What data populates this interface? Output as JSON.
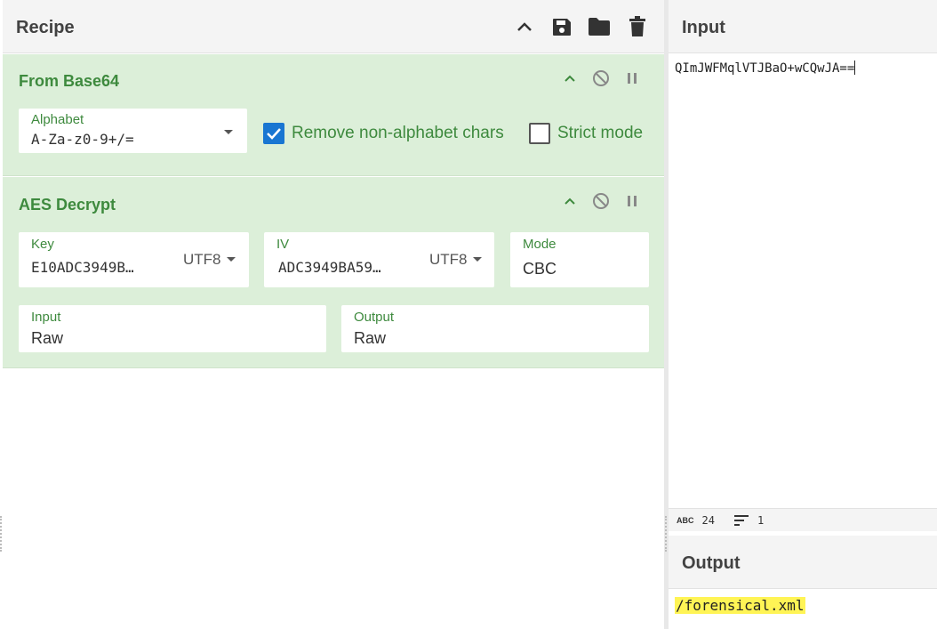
{
  "recipe": {
    "title": "Recipe",
    "toolbar_icons": [
      "chevron-up-icon",
      "save-icon",
      "folder-icon",
      "trash-icon"
    ],
    "operations": [
      {
        "name": "From Base64",
        "alphabet": {
          "label": "Alphabet",
          "value": "A-Za-z0-9+/="
        },
        "remove_non_alphabet": {
          "label": "Remove non-alphabet chars",
          "checked": true
        },
        "strict_mode": {
          "label": "Strict mode",
          "checked": false
        }
      },
      {
        "name": "AES Decrypt",
        "key": {
          "label": "Key",
          "value": "E10ADC3949B…",
          "encoding": "UTF8"
        },
        "iv": {
          "label": "IV",
          "value": "ADC3949BA59…",
          "encoding": "UTF8"
        },
        "mode": {
          "label": "Mode",
          "value": "CBC"
        },
        "input": {
          "label": "Input",
          "value": "Raw"
        },
        "output": {
          "label": "Output",
          "value": "Raw"
        }
      }
    ]
  },
  "input_pane": {
    "title": "Input",
    "text": "QImJWFMqlVTJBaO+wCQwJA==",
    "stats": {
      "chars_icon": "abc-icon",
      "chars": "24",
      "lines_icon": "lines-icon",
      "lines": "1"
    }
  },
  "output_pane": {
    "title": "Output",
    "text": "/forensical.xml",
    "highlight_color": "#fff455"
  },
  "colors": {
    "op_background": "#dcefd9",
    "op_title": "#3e8a3e",
    "checkbox_accent": "#1976d2"
  }
}
